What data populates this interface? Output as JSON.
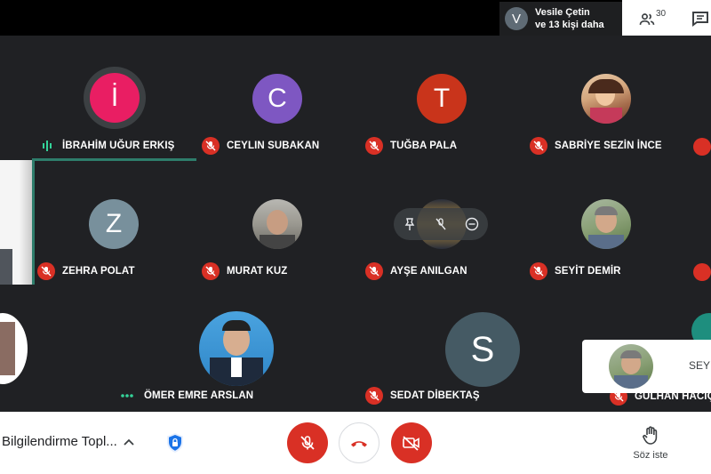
{
  "header": {
    "presenter": {
      "initial": "V",
      "line1": "Vesile Çetin",
      "line2": "ve 13 kişi daha"
    },
    "people_count": "30",
    "people_icon": "people-icon",
    "chat_icon": "chat-icon"
  },
  "participants": [
    {
      "id": "ibrahim",
      "name": "İBRAHİM UĞUR ERKIŞ",
      "initial": "İ",
      "color": "#e91e63",
      "speaking": true
    },
    {
      "id": "ceylin",
      "name": "CEYLIN SUBAKAN",
      "initial": "C",
      "color": "#7e57c2",
      "muted": true
    },
    {
      "id": "tugba",
      "name": "TUĞBA PALA",
      "initial": "T",
      "color": "#c9341b",
      "muted": true
    },
    {
      "id": "sabriye",
      "name": "SABRİYE SEZİN İNCE",
      "photo": true,
      "muted": true
    },
    {
      "id": "zehra",
      "name": "ZEHRA POLAT",
      "initial": "Z",
      "color": "#78909c",
      "muted": true
    },
    {
      "id": "murat",
      "name": "MURAT KUZ",
      "photo": true,
      "muted": true
    },
    {
      "id": "ayse",
      "name": "AYŞE ANILGAN",
      "photo": true,
      "muted": true
    },
    {
      "id": "seyit",
      "name": "SEYİT DEMİR",
      "photo": true,
      "muted": true
    },
    {
      "id": "omer",
      "name": "ÖMER EMRE ARSLAN",
      "photo": true,
      "muted": false
    },
    {
      "id": "sedat",
      "name": "SEDAT DİBEKTAŞ",
      "initial": "S",
      "color": "#455a64",
      "muted": true
    },
    {
      "id": "gulhan",
      "name": "GÜLHAN HACIÇA",
      "muted": true
    }
  ],
  "self_view": {
    "label": "SEYİT"
  },
  "footer": {
    "meeting_title": "Bilgilendirme Topl...",
    "raise_hand_label": "Söz iste",
    "colors": {
      "danger": "#d93025",
      "brand_green": "#34a853"
    }
  }
}
